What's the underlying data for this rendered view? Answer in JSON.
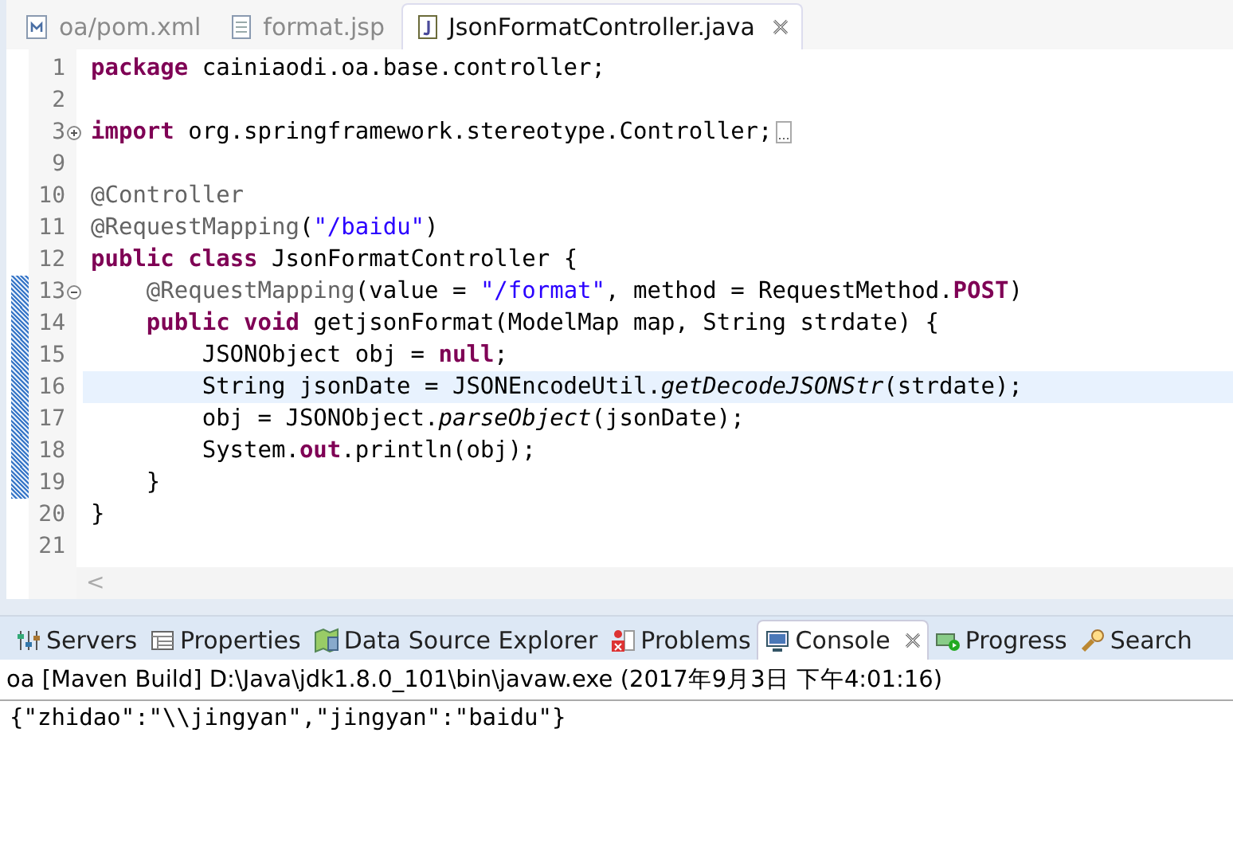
{
  "editor_tabs": [
    {
      "label": "oa/pom.xml",
      "selected": false
    },
    {
      "label": "format.jsp",
      "selected": false
    },
    {
      "label": "JsonFormatController.java",
      "selected": true
    }
  ],
  "lines": [
    {
      "number": "1",
      "changed": false,
      "current": false,
      "text": "**package** cainiaodi.oa.base.controller;"
    },
    {
      "number": "2",
      "changed": false,
      "current": false
    },
    {
      "number": "3",
      "changed": false,
      "current": false,
      "folded": true,
      "text": "**import** org.springframework.stereotype.Controller;"
    },
    {
      "number": "9",
      "changed": false,
      "current": false
    },
    {
      "number": "10",
      "changed": false,
      "current": false,
      "text": "@Controller"
    },
    {
      "number": "11",
      "changed": false,
      "current": false,
      "text": "@RequestMapping(\"/baidu\")"
    },
    {
      "number": "12",
      "changed": false,
      "current": false,
      "text": "**public** **class** JsonFormatController {"
    },
    {
      "number": "13",
      "changed": true,
      "current": false,
      "folded": false,
      "text": "    @RequestMapping(value = \"/format\", method = RequestMethod.**POST**)"
    },
    {
      "number": "14",
      "changed": true,
      "current": false,
      "text": "    **public** **void** getjsonFormat(ModelMap map, String strdate) {"
    },
    {
      "number": "15",
      "changed": true,
      "current": false,
      "text": "        JSONObject obj = **null**;"
    },
    {
      "number": "16",
      "changed": true,
      "current": true,
      "text": "        String jsonDate = JSONEncodeUtil.*getDecodeJSONStr*(strdate);"
    },
    {
      "number": "17",
      "changed": true,
      "current": false,
      "text": "        obj = JSONObject.*parseObject*(jsonDate);"
    },
    {
      "number": "18",
      "changed": true,
      "current": false,
      "text": "        System.**out**.println(obj);"
    },
    {
      "number": "19",
      "changed": true,
      "current": false,
      "text": "    }"
    },
    {
      "number": "20",
      "changed": false,
      "current": false,
      "text": "}"
    },
    {
      "number": "21",
      "changed": false,
      "current": false
    }
  ],
  "scroll_left": "<",
  "panel_tabs": [
    {
      "label": "Servers",
      "selected": false
    },
    {
      "label": "Properties",
      "selected": false
    },
    {
      "label": "Data Source Explorer",
      "selected": false
    },
    {
      "label": "Problems",
      "selected": false
    },
    {
      "label": "Console",
      "selected": true
    },
    {
      "label": "Progress",
      "selected": false
    },
    {
      "label": "Search",
      "selected": false
    }
  ],
  "console": {
    "title": "oa [Maven Build] D:\\Java\\jdk1.8.0_101\\bin\\javaw.exe (2017年9月3日 下午4:01:16)",
    "output": "{\"zhidao\":\"\\\\jingyan\",\"jingyan\":\"baidu\"}"
  }
}
